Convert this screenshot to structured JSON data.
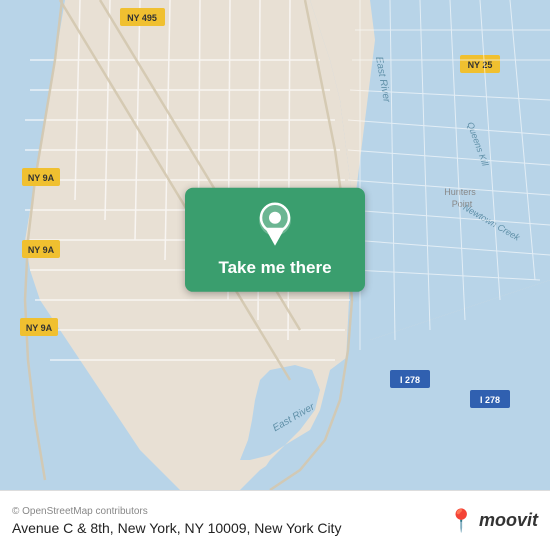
{
  "map": {
    "alt": "Map of New York City showing lower Manhattan and surrounding areas"
  },
  "overlay": {
    "button_label": "Take me there",
    "pin_icon": "location-pin"
  },
  "bottom_bar": {
    "attribution": "© OpenStreetMap contributors",
    "location": "Avenue C & 8th, New York, NY 10009, New York City",
    "moovit_label": "moovit"
  },
  "colors": {
    "overlay_green": "#3a9e6e",
    "moovit_red": "#e8431d"
  }
}
